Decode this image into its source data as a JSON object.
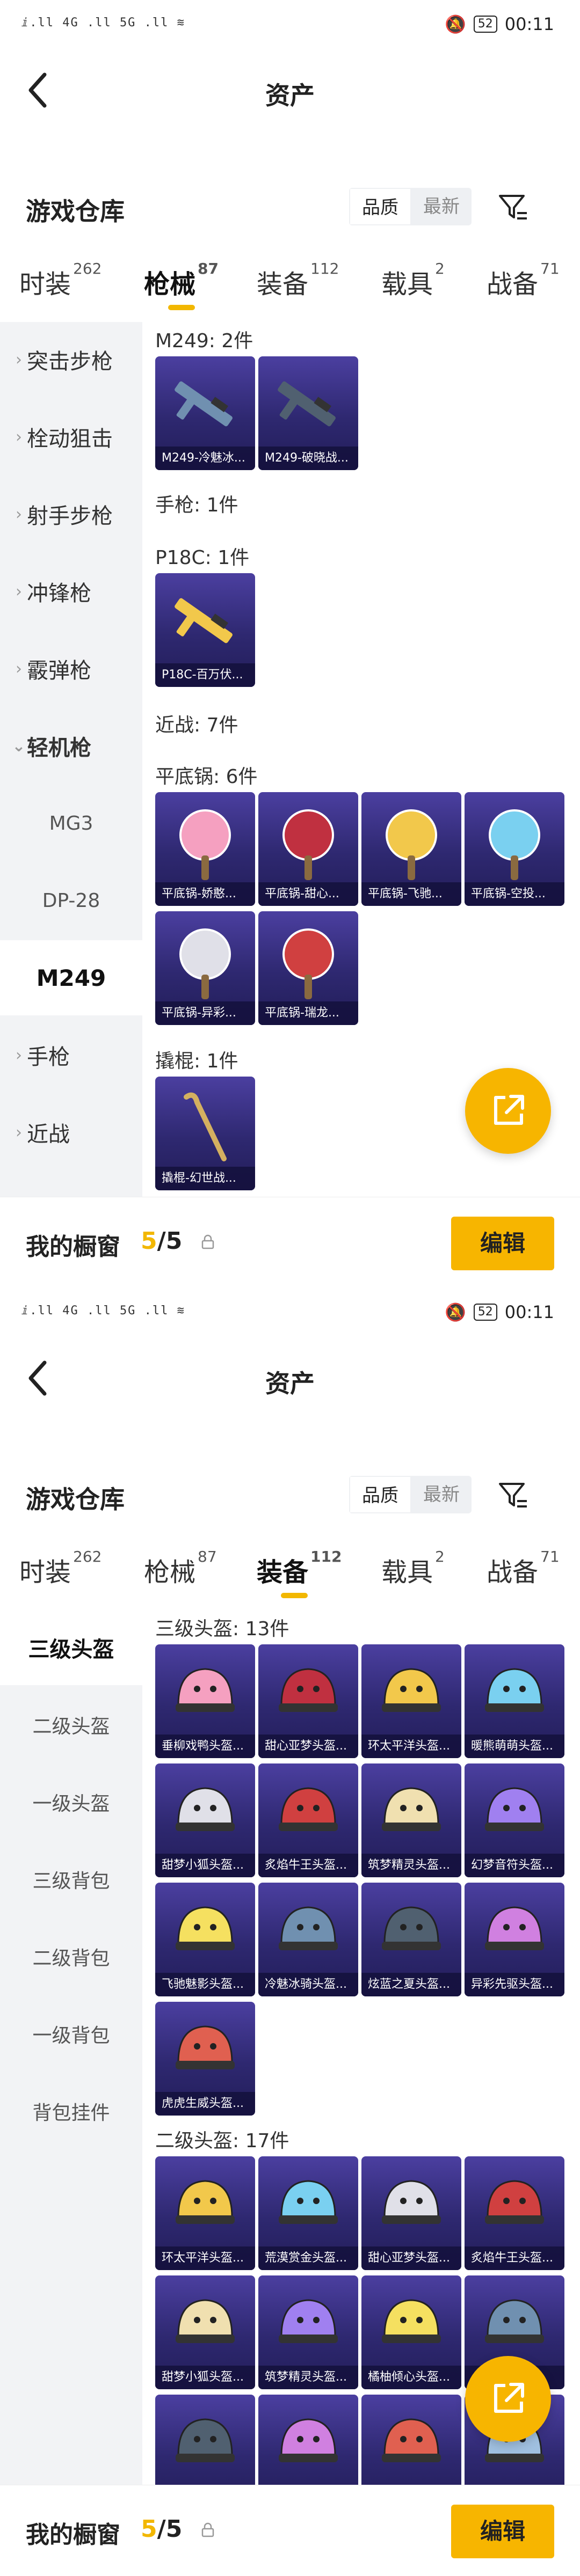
{
  "status": {
    "left": "ⅈ.ll 4G .ll 5G .ll ≋",
    "battery": "52",
    "time": "00:11"
  },
  "nav": {
    "title": "资产"
  },
  "warehouse": {
    "title": "游戏仓库",
    "sort_quality": "品质",
    "sort_latest": "最新"
  },
  "tabs": [
    {
      "label": "时装",
      "count": "262"
    },
    {
      "label": "枪械",
      "count": "87"
    },
    {
      "label": "装备",
      "count": "112"
    },
    {
      "label": "载具",
      "count": "2"
    },
    {
      "label": "战备",
      "count": "71"
    }
  ],
  "footer": {
    "label": "我的橱窗",
    "current": "5",
    "sep": "/",
    "total": "5",
    "edit": "编辑"
  },
  "screen1": {
    "sidebar": [
      "突击步枪",
      "栓动狙击",
      "射手步枪",
      "冲锋枪",
      "霰弹枪",
      "轻机枪",
      "MG3",
      "DP-28",
      "M249",
      "手枪",
      "近战"
    ],
    "sections": {
      "m249": "M249: 2件",
      "pistol": "手枪: 1件",
      "p18c": "P18C: 1件",
      "melee": "近战: 7件",
      "pan": "平底锅: 6件",
      "crowbar": "撬棍: 1件"
    },
    "items": {
      "m249": [
        "M249-冷魅冰...",
        "M249-破晓战..."
      ],
      "p18c": [
        "P18C-百万伏..."
      ],
      "pan": [
        "平底锅-娇憨...",
        "平底锅-甜心...",
        "平底锅-飞驰...",
        "平底锅-空投...",
        "平底锅-异彩...",
        "平底锅-瑞龙..."
      ],
      "crowbar": [
        "撬棍-幻世战..."
      ]
    }
  },
  "screen2": {
    "sidebar": [
      "三级头盔",
      "二级头盔",
      "一级头盔",
      "三级背包",
      "二级背包",
      "一级背包",
      "背包挂件"
    ],
    "sections": {
      "lv3": "三级头盔: 13件",
      "lv2": "二级头盔: 17件"
    },
    "items": {
      "lv3": [
        "垂柳戏鸭头盔...",
        "甜心亚梦头盔...",
        "环太平洋头盔...",
        "暖熊萌萌头盔...",
        "甜梦小狐头盔...",
        "炙焰牛王头盔...",
        "筑梦精灵头盔...",
        "幻梦音符头盔...",
        "飞驰魅影头盔...",
        "冷魅冰骑头盔...",
        "炫蓝之夏头盔...",
        "异彩先驱头盔...",
        "虎虎生威头盔..."
      ],
      "lv2": [
        "环太平洋头盔...",
        "荒漠赏金头盔...",
        "甜心亚梦头盔...",
        "炙焰牛王头盔...",
        "甜梦小狐头盔...",
        "筑梦精灵头盔...",
        "橘柚倾心头盔...",
        "",
        "",
        "",
        "",
        ""
      ]
    }
  },
  "colors": {
    "accent": "#f7b500",
    "card_bg": "#2e2870",
    "sidebar_bg": "#f2f3f5"
  }
}
